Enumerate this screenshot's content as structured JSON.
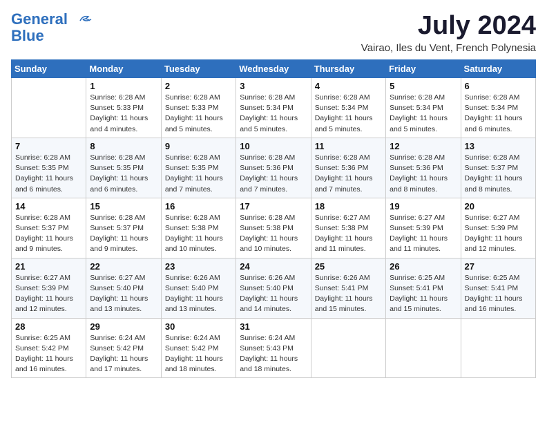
{
  "logo": {
    "line1": "General",
    "line2": "Blue"
  },
  "title": "July 2024",
  "subtitle": "Vairao, Iles du Vent, French Polynesia",
  "weekdays": [
    "Sunday",
    "Monday",
    "Tuesday",
    "Wednesday",
    "Thursday",
    "Friday",
    "Saturday"
  ],
  "weeks": [
    [
      {
        "day": "",
        "info": ""
      },
      {
        "day": "1",
        "info": "Sunrise: 6:28 AM\nSunset: 5:33 PM\nDaylight: 11 hours\nand 4 minutes."
      },
      {
        "day": "2",
        "info": "Sunrise: 6:28 AM\nSunset: 5:33 PM\nDaylight: 11 hours\nand 5 minutes."
      },
      {
        "day": "3",
        "info": "Sunrise: 6:28 AM\nSunset: 5:34 PM\nDaylight: 11 hours\nand 5 minutes."
      },
      {
        "day": "4",
        "info": "Sunrise: 6:28 AM\nSunset: 5:34 PM\nDaylight: 11 hours\nand 5 minutes."
      },
      {
        "day": "5",
        "info": "Sunrise: 6:28 AM\nSunset: 5:34 PM\nDaylight: 11 hours\nand 5 minutes."
      },
      {
        "day": "6",
        "info": "Sunrise: 6:28 AM\nSunset: 5:34 PM\nDaylight: 11 hours\nand 6 minutes."
      }
    ],
    [
      {
        "day": "7",
        "info": "Sunrise: 6:28 AM\nSunset: 5:35 PM\nDaylight: 11 hours\nand 6 minutes."
      },
      {
        "day": "8",
        "info": "Sunrise: 6:28 AM\nSunset: 5:35 PM\nDaylight: 11 hours\nand 6 minutes."
      },
      {
        "day": "9",
        "info": "Sunrise: 6:28 AM\nSunset: 5:35 PM\nDaylight: 11 hours\nand 7 minutes."
      },
      {
        "day": "10",
        "info": "Sunrise: 6:28 AM\nSunset: 5:36 PM\nDaylight: 11 hours\nand 7 minutes."
      },
      {
        "day": "11",
        "info": "Sunrise: 6:28 AM\nSunset: 5:36 PM\nDaylight: 11 hours\nand 7 minutes."
      },
      {
        "day": "12",
        "info": "Sunrise: 6:28 AM\nSunset: 5:36 PM\nDaylight: 11 hours\nand 8 minutes."
      },
      {
        "day": "13",
        "info": "Sunrise: 6:28 AM\nSunset: 5:37 PM\nDaylight: 11 hours\nand 8 minutes."
      }
    ],
    [
      {
        "day": "14",
        "info": "Sunrise: 6:28 AM\nSunset: 5:37 PM\nDaylight: 11 hours\nand 9 minutes."
      },
      {
        "day": "15",
        "info": "Sunrise: 6:28 AM\nSunset: 5:37 PM\nDaylight: 11 hours\nand 9 minutes."
      },
      {
        "day": "16",
        "info": "Sunrise: 6:28 AM\nSunset: 5:38 PM\nDaylight: 11 hours\nand 10 minutes."
      },
      {
        "day": "17",
        "info": "Sunrise: 6:28 AM\nSunset: 5:38 PM\nDaylight: 11 hours\nand 10 minutes."
      },
      {
        "day": "18",
        "info": "Sunrise: 6:27 AM\nSunset: 5:38 PM\nDaylight: 11 hours\nand 11 minutes."
      },
      {
        "day": "19",
        "info": "Sunrise: 6:27 AM\nSunset: 5:39 PM\nDaylight: 11 hours\nand 11 minutes."
      },
      {
        "day": "20",
        "info": "Sunrise: 6:27 AM\nSunset: 5:39 PM\nDaylight: 11 hours\nand 12 minutes."
      }
    ],
    [
      {
        "day": "21",
        "info": "Sunrise: 6:27 AM\nSunset: 5:39 PM\nDaylight: 11 hours\nand 12 minutes."
      },
      {
        "day": "22",
        "info": "Sunrise: 6:27 AM\nSunset: 5:40 PM\nDaylight: 11 hours\nand 13 minutes."
      },
      {
        "day": "23",
        "info": "Sunrise: 6:26 AM\nSunset: 5:40 PM\nDaylight: 11 hours\nand 13 minutes."
      },
      {
        "day": "24",
        "info": "Sunrise: 6:26 AM\nSunset: 5:40 PM\nDaylight: 11 hours\nand 14 minutes."
      },
      {
        "day": "25",
        "info": "Sunrise: 6:26 AM\nSunset: 5:41 PM\nDaylight: 11 hours\nand 15 minutes."
      },
      {
        "day": "26",
        "info": "Sunrise: 6:25 AM\nSunset: 5:41 PM\nDaylight: 11 hours\nand 15 minutes."
      },
      {
        "day": "27",
        "info": "Sunrise: 6:25 AM\nSunset: 5:41 PM\nDaylight: 11 hours\nand 16 minutes."
      }
    ],
    [
      {
        "day": "28",
        "info": "Sunrise: 6:25 AM\nSunset: 5:42 PM\nDaylight: 11 hours\nand 16 minutes."
      },
      {
        "day": "29",
        "info": "Sunrise: 6:24 AM\nSunset: 5:42 PM\nDaylight: 11 hours\nand 17 minutes."
      },
      {
        "day": "30",
        "info": "Sunrise: 6:24 AM\nSunset: 5:42 PM\nDaylight: 11 hours\nand 18 minutes."
      },
      {
        "day": "31",
        "info": "Sunrise: 6:24 AM\nSunset: 5:43 PM\nDaylight: 11 hours\nand 18 minutes."
      },
      {
        "day": "",
        "info": ""
      },
      {
        "day": "",
        "info": ""
      },
      {
        "day": "",
        "info": ""
      }
    ]
  ]
}
